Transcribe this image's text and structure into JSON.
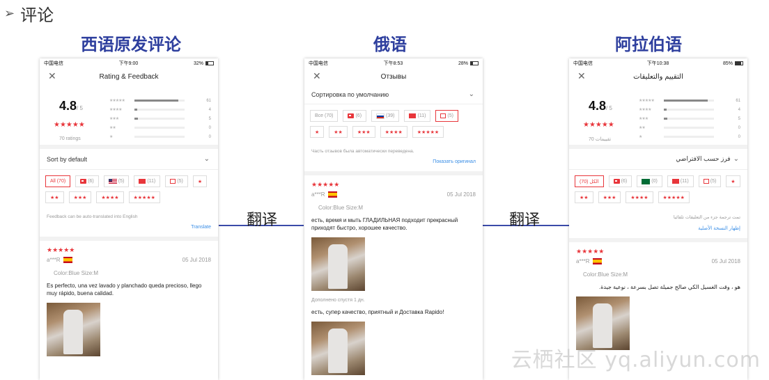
{
  "slide": {
    "title": "评论",
    "arrow": "➢"
  },
  "columns": [
    {
      "title": "西语原发评论"
    },
    {
      "title": "俄语"
    },
    {
      "title": "阿拉伯语"
    }
  ],
  "connectors": [
    {
      "label": "翻译"
    },
    {
      "label": "翻译"
    }
  ],
  "watermark": "云栖社区 yq.aliyun.com",
  "phone_es": {
    "status": {
      "carrier": "中国电信",
      "time": "下午9:00",
      "battery": "32%"
    },
    "nav_title": "Rating & Feedback",
    "score": "4.8",
    "score_suffix": "/ 5",
    "ratings_count": "70 ratings",
    "distribution": [
      {
        "stars": "★★★★★",
        "count": "61",
        "fraction": 0.87
      },
      {
        "stars": "★★★★",
        "count": "4",
        "fraction": 0.06
      },
      {
        "stars": "★★★",
        "count": "5",
        "fraction": 0.07
      },
      {
        "stars": "★★",
        "count": "0",
        "fraction": 0
      },
      {
        "stars": "★",
        "count": "0",
        "fraction": 0
      }
    ],
    "sort_label": "Sort by default",
    "chips": {
      "all": "All (70)",
      "photo": "(6)",
      "flag": "(5)",
      "tag": "(11)",
      "msg": "(5)",
      "s1": "★",
      "s2": "★★",
      "s3": "★★★",
      "s4": "★★★★",
      "s5": "★★★★★"
    },
    "note": "Feedback can be auto-translated into English",
    "link": "Translate",
    "review": {
      "stars": "★★★★★",
      "user": "a***R",
      "date": "05 Jul 2018",
      "sku": "Color:Blue Size:M",
      "body": "Es perfecto, una vez lavado y planchado queda precioso, llego muy rápido, buena calidad."
    }
  },
  "phone_ru": {
    "status": {
      "carrier": "中国电信",
      "time": "下午8:53",
      "battery": "28%"
    },
    "nav_title": "Отзывы",
    "sort_label": "Сортировка по умолчанию",
    "chips": {
      "all": "Все (70)",
      "photo": "(6)",
      "flag": "(39)",
      "tag": "(11)",
      "msg": "(5)",
      "s1": "★",
      "s2": "★★",
      "s3": "★★★",
      "s4": "★★★★",
      "s5": "★★★★★"
    },
    "note": "Часть отзывов была автоматически переведена.",
    "link": "Показать оригинал",
    "review": {
      "stars": "★★★★★",
      "user": "a***R",
      "date": "05 Jul 2018",
      "sku": "Color:Blue Size:M",
      "body": "есть, время и мыть ГЛАДИЛЬНАЯ подходит прекрасный приходят быстро, хорошее качество.",
      "added": "Дополнено спустя 1 дн.",
      "body2": "есть, супер качество, приятный и Доставка Rapido!"
    }
  },
  "phone_ar": {
    "status": {
      "carrier": "中国电信",
      "time": "下午10:38",
      "battery": "85%"
    },
    "nav_title": "التقييم والتعليقات",
    "score": "4.8",
    "score_suffix": "/ 5",
    "ratings_count": "70 تقييمات",
    "distribution": [
      {
        "stars": "★★★★★",
        "count": "61",
        "fraction": 0.87
      },
      {
        "stars": "★★★★",
        "count": "4",
        "fraction": 0.06
      },
      {
        "stars": "★★★",
        "count": "5",
        "fraction": 0.07
      },
      {
        "stars": "★★",
        "count": "0",
        "fraction": 0
      },
      {
        "stars": "★",
        "count": "0",
        "fraction": 0
      }
    ],
    "sort_label": "فرز حسب الافتراضي",
    "chips": {
      "all": "الكل (70)",
      "photo": "(6)",
      "flag": "(0)",
      "tag": "(11)",
      "msg": "(5)",
      "s1": "★",
      "s2": "★★",
      "s3": "★★★",
      "s4": "★★★★",
      "s5": "★★★★★"
    },
    "note": "تمت ترجمة جزء من التعليقات تلقائيا",
    "link": "إظهار النسخة الأصلية",
    "review": {
      "stars": "★★★★★",
      "user": "a***R",
      "date": "05 Jul 2018",
      "sku": "Color:Blue Size:M",
      "body": "هو ، وقت الغسيل الكي صالح جميلة تصل بسرعة ، نوعية جيدة."
    }
  }
}
